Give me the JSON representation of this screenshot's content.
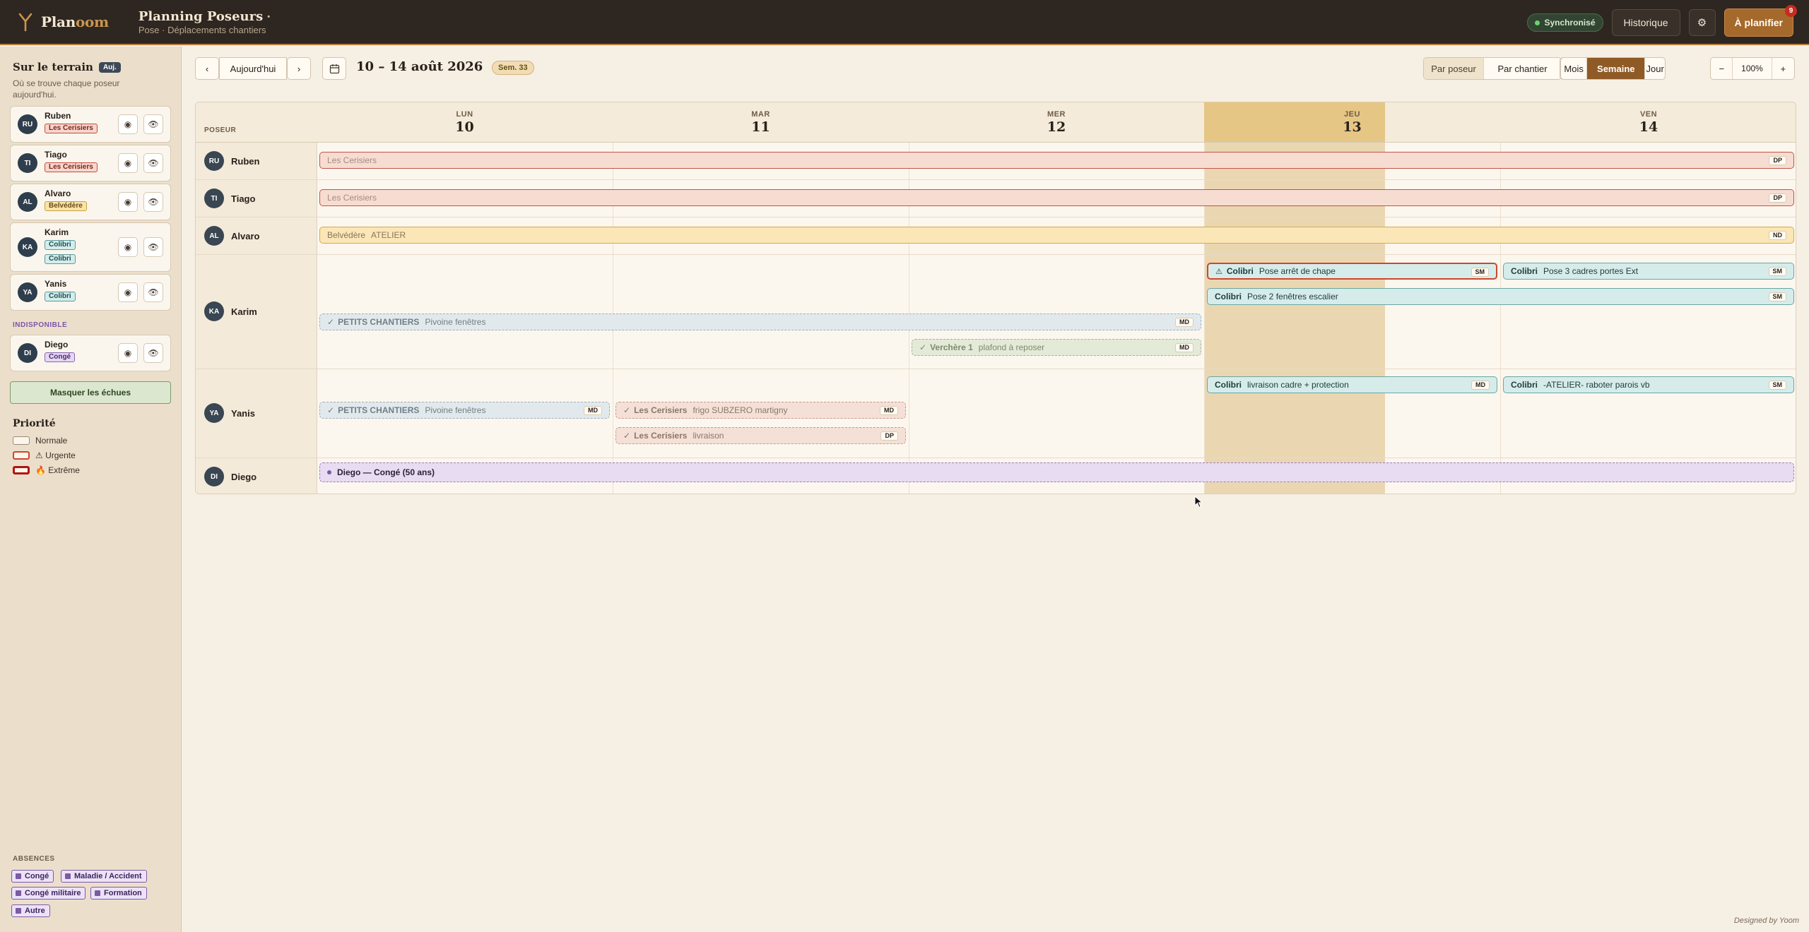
{
  "app": {
    "brand_a": "Plan",
    "brand_b": "oom",
    "title": "Planning Poseurs",
    "title_dot": "•",
    "subtitle": "Pose · Déplacements chantiers"
  },
  "top": {
    "sync": "Synchronisé",
    "history": "Historique",
    "gear": "⚙",
    "plan": "À planifier",
    "plan_badge": "9"
  },
  "sidebar": {
    "title": "Sur le terrain",
    "today_chip": "Auj.",
    "desc": "Où se trouve chaque poseur aujourd'hui.",
    "people": [
      {
        "initials": "RU",
        "name": "Ruben",
        "tags": [
          "Les Cerisiers"
        ]
      },
      {
        "initials": "TI",
        "name": "Tiago",
        "tags": [
          "Les Cerisiers"
        ]
      },
      {
        "initials": "AL",
        "name": "Alvaro",
        "tags": [
          "Belvédère"
        ]
      },
      {
        "initials": "KA",
        "name": "Karim",
        "tags": [
          "Colibri",
          "Colibri"
        ]
      },
      {
        "initials": "YA",
        "name": "Yanis",
        "tags": [
          "Colibri"
        ]
      }
    ],
    "unavailable_label": "INDISPONIBLE",
    "unavailable": [
      {
        "initials": "DI",
        "name": "Diego",
        "tags": [
          "Congé"
        ]
      }
    ],
    "hide_button": "Masquer les échues",
    "priority_title": "Priorité",
    "priorities": [
      "Normale",
      "⚠ Urgente",
      "🔥 Extrême"
    ],
    "absences_label": "ABSENCES",
    "absences": [
      "Congé",
      "Maladie / Accident",
      "Congé militaire",
      "Formation",
      "Autre"
    ]
  },
  "toolbar": {
    "prev": "‹",
    "today": "Aujourd'hui",
    "next": "›",
    "date_range": "10 – 14 août 2026",
    "week": "Sem. 33",
    "by_poseur": "Par poseur",
    "by_chantier": "Par chantier",
    "month": "Mois",
    "week_view": "Semaine",
    "day": "Jour",
    "zoom_out": "−",
    "zoom": "100%",
    "zoom_in": "+"
  },
  "grid": {
    "poseur_header": "POSEUR",
    "days": [
      {
        "name": "LUN",
        "num": "10"
      },
      {
        "name": "MAR",
        "num": "11"
      },
      {
        "name": "MER",
        "num": "12"
      },
      {
        "name": "JEU",
        "num": "13"
      },
      {
        "name": "VEN",
        "num": "14"
      }
    ],
    "rows": [
      {
        "initials": "RU",
        "name": "Ruben"
      },
      {
        "initials": "TI",
        "name": "Tiago"
      },
      {
        "initials": "AL",
        "name": "Alvaro"
      },
      {
        "initials": "KA",
        "name": "Karim"
      },
      {
        "initials": "YA",
        "name": "Yanis"
      },
      {
        "initials": "DI",
        "name": "Diego"
      }
    ],
    "events": {
      "ruben_1": {
        "client": "Les Cerisiers",
        "text": "",
        "init": "DP"
      },
      "tiago_1": {
        "client": "Les Cerisiers",
        "text": "",
        "init": "DP"
      },
      "alvaro_1": {
        "client": "Belvédère",
        "text": "ATELIER",
        "init": "ND"
      },
      "karim_1": {
        "client": "Colibri",
        "text": "Pose arrêt de chape",
        "init": "SM",
        "icon": "⚠"
      },
      "karim_2": {
        "client": "Colibri",
        "text": "Pose 3 cadres portes Ext",
        "init": "SM"
      },
      "karim_3": {
        "client": "Colibri",
        "text": "Pose 2 fenêtres escalier",
        "init": "SM"
      },
      "karim_4": {
        "client": "PETITS CHANTIERS",
        "text": "Pivoine fenêtres",
        "init": "MD",
        "icon": "✓"
      },
      "karim_5": {
        "client": "Verchère 1",
        "text": "plafond à reposer",
        "init": "MD",
        "icon": "✓"
      },
      "yanis_1": {
        "client": "Colibri",
        "text": "livraison cadre + protection",
        "init": "MD"
      },
      "yanis_2": {
        "client": "Colibri",
        "text": "-ATELIER- raboter parois vb",
        "init": "SM"
      },
      "yanis_3": {
        "client": "PETITS CHANTIERS",
        "text": "Pivoine fenêtres",
        "init": "MD",
        "icon": "✓"
      },
      "yanis_4": {
        "client": "Les Cerisiers",
        "text": "frigo SUBZERO martigny",
        "init": "MD",
        "icon": "✓"
      },
      "yanis_5": {
        "client": "Les Cerisiers",
        "text": "livraison",
        "init": "DP",
        "icon": "✓"
      },
      "diego_1": {
        "text": "Diego — Congé (50 ans)"
      }
    }
  },
  "credit": "Designed by Yoom",
  "colors": {
    "accent": "#a5692b",
    "urgent": "#d0452d",
    "today_col": "#ead7b1"
  }
}
